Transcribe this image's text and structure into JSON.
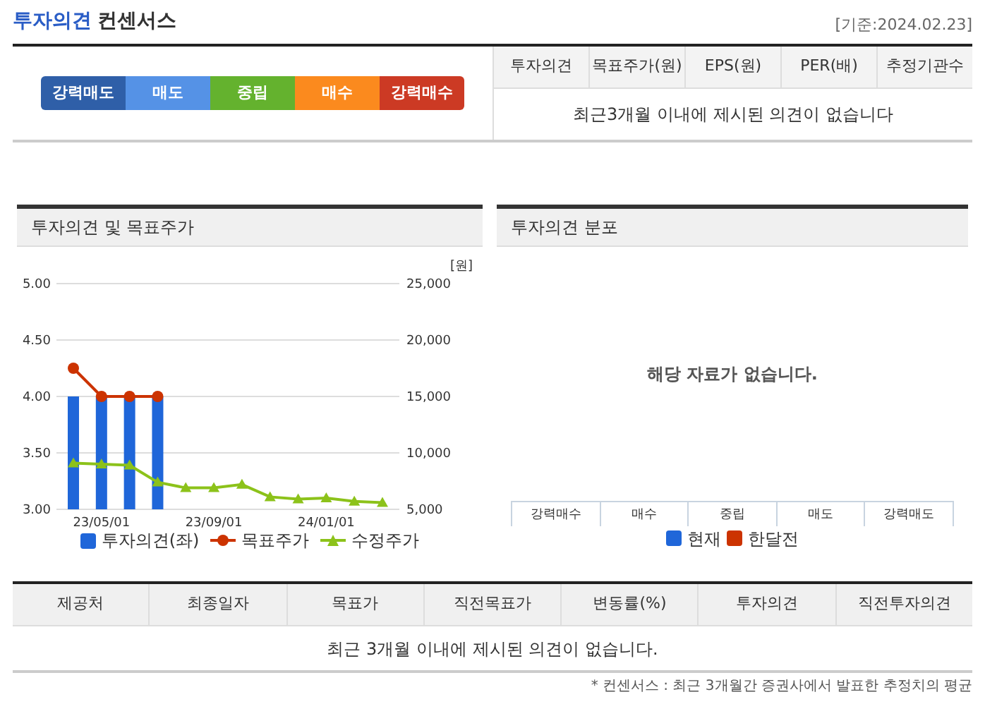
{
  "header": {
    "title_highlight": "투자의견",
    "title_rest": "컨센서스",
    "date": "[기준:2024.02.23]"
  },
  "opinion_scale": [
    {
      "label": "강력매도",
      "color": "#2f5fa8"
    },
    {
      "label": "매도",
      "color": "#5592e6"
    },
    {
      "label": "중립",
      "color": "#64b22e"
    },
    {
      "label": "매수",
      "color": "#fb8a1e"
    },
    {
      "label": "강력매수",
      "color": "#cc3a24"
    }
  ],
  "summary_table": {
    "columns": [
      "투자의견",
      "목표주가(원)",
      "EPS(원)",
      "PER(배)",
      "추정기관수"
    ],
    "empty_message": "최근3개월 이내에 제시된 의견이 없습니다"
  },
  "opinion_target_panel": {
    "title": "투자의견 및 목표주가",
    "price_chart": {
      "chart_data": {
        "type": "line",
        "grid": true,
        "legend": "bottom",
        "ylabel": "[원]",
        "categories": [
          null,
          "23/05/01",
          null,
          null,
          null,
          "23/09/01",
          null,
          null,
          null,
          "24/01/01",
          null,
          null
        ],
        "ylim": [
          5000,
          25000
        ],
        "yticks": [
          {
            "value": 5000,
            "label": "5,000"
          },
          {
            "value": 10000,
            "label": "10,000"
          },
          {
            "value": 15000,
            "label": "15,000"
          },
          {
            "value": 20000,
            "label": "20,000"
          },
          {
            "value": 25000,
            "label": "25,000"
          }
        ],
        "series": [
          {
            "name": "목표주가",
            "color": "#cc3300",
            "marker": "circle",
            "values": [
              17500,
              15000,
              15000,
              15000,
              null,
              null,
              null,
              null,
              null,
              null,
              null,
              null
            ]
          },
          {
            "name": "수정주가",
            "color": "#8cc21a",
            "marker": "triangle",
            "values": [
              9100,
              9000,
              8900,
              7400,
              6900,
              6900,
              7200,
              6100,
              5900,
              6000,
              5700,
              5600
            ]
          }
        ]
      }
    },
    "opinion_bars": {
      "chart_data": {
        "type": "bar",
        "ylim": [
          3,
          5
        ],
        "yticks": [
          {
            "value": 3,
            "label": "3.00"
          },
          {
            "value": 3.5,
            "label": "3.50"
          },
          {
            "value": 4,
            "label": "4.00"
          },
          {
            "value": 4.5,
            "label": "4.50"
          },
          {
            "value": 5,
            "label": "5.00"
          }
        ],
        "series": [
          {
            "name": "투자의견(좌)",
            "color": "#1f66d9",
            "values": [
              4,
              4,
              4,
              4,
              null,
              null,
              null,
              null,
              null,
              null,
              null,
              null
            ]
          }
        ]
      }
    }
  },
  "distribution_panel": {
    "title": "투자의견 분포",
    "empty_message": "해당 자료가 없습니다.",
    "categories": [
      "강력매수",
      "매수",
      "중립",
      "매도",
      "강력매도"
    ],
    "legend": [
      {
        "label": "현재",
        "color": "#1f66d9"
      },
      {
        "label": "한달전",
        "color": "#cc3300"
      }
    ]
  },
  "provider_table": {
    "columns": [
      "제공처",
      "최종일자",
      "목표가",
      "직전목표가",
      "변동률(%)",
      "투자의견",
      "직전투자의견"
    ],
    "empty_message": "최근 3개월 이내에 제시된 의견이 없습니다."
  },
  "footnote": "* 컨센서스 : 최근 3개월간 증권사에서 발표한 추정치의 평균"
}
